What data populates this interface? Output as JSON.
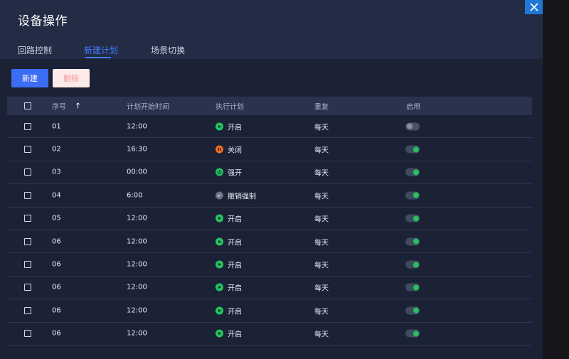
{
  "dialog": {
    "title": "设备操作"
  },
  "tabs": [
    {
      "label": "回路控制",
      "active": false
    },
    {
      "label": "新建计划",
      "active": true
    },
    {
      "label": "场景切换",
      "active": false
    }
  ],
  "toolbar": {
    "new_label": "新建",
    "delete_label": "删除"
  },
  "table": {
    "headers": {
      "seq": "序号",
      "sort_icon": "↑",
      "time": "计划开始时间",
      "plan": "执行计划",
      "repeat": "重复",
      "enabled": "启用"
    },
    "rows": [
      {
        "seq": "01",
        "time": "12:00",
        "plan": "开启",
        "plan_icon": "play-icon",
        "repeat": "每天",
        "enabled": false
      },
      {
        "seq": "02",
        "time": "16:30",
        "plan": "关闭",
        "plan_icon": "pause-icon",
        "repeat": "每天",
        "enabled": true
      },
      {
        "seq": "03",
        "time": "00:00",
        "plan": "强开",
        "plan_icon": "power-icon",
        "repeat": "每天",
        "enabled": true
      },
      {
        "seq": "04",
        "time": "6:00",
        "plan": "撤销强制",
        "plan_icon": "undo-icon",
        "repeat": "每天",
        "enabled": true
      },
      {
        "seq": "05",
        "time": "12:00",
        "plan": "开启",
        "plan_icon": "play-icon",
        "repeat": "每天",
        "enabled": true
      },
      {
        "seq": "06",
        "time": "12:00",
        "plan": "开启",
        "plan_icon": "play-icon",
        "repeat": "每天",
        "enabled": true
      },
      {
        "seq": "06",
        "time": "12:00",
        "plan": "开启",
        "plan_icon": "play-icon",
        "repeat": "每天",
        "enabled": true
      },
      {
        "seq": "06",
        "time": "12:00",
        "plan": "开启",
        "plan_icon": "play-icon",
        "repeat": "每天",
        "enabled": true
      },
      {
        "seq": "06",
        "time": "12:00",
        "plan": "开启",
        "plan_icon": "play-icon",
        "repeat": "每天",
        "enabled": true
      },
      {
        "seq": "06",
        "time": "12:00",
        "plan": "开启",
        "plan_icon": "play-icon",
        "repeat": "每天",
        "enabled": true
      }
    ]
  },
  "colors": {
    "accent": "#3f7bff",
    "play": "#22c55e",
    "pause": "#f26b1d",
    "power": "#22c55e",
    "undo": "#6b7280",
    "toggle_on": "#25c25a"
  }
}
